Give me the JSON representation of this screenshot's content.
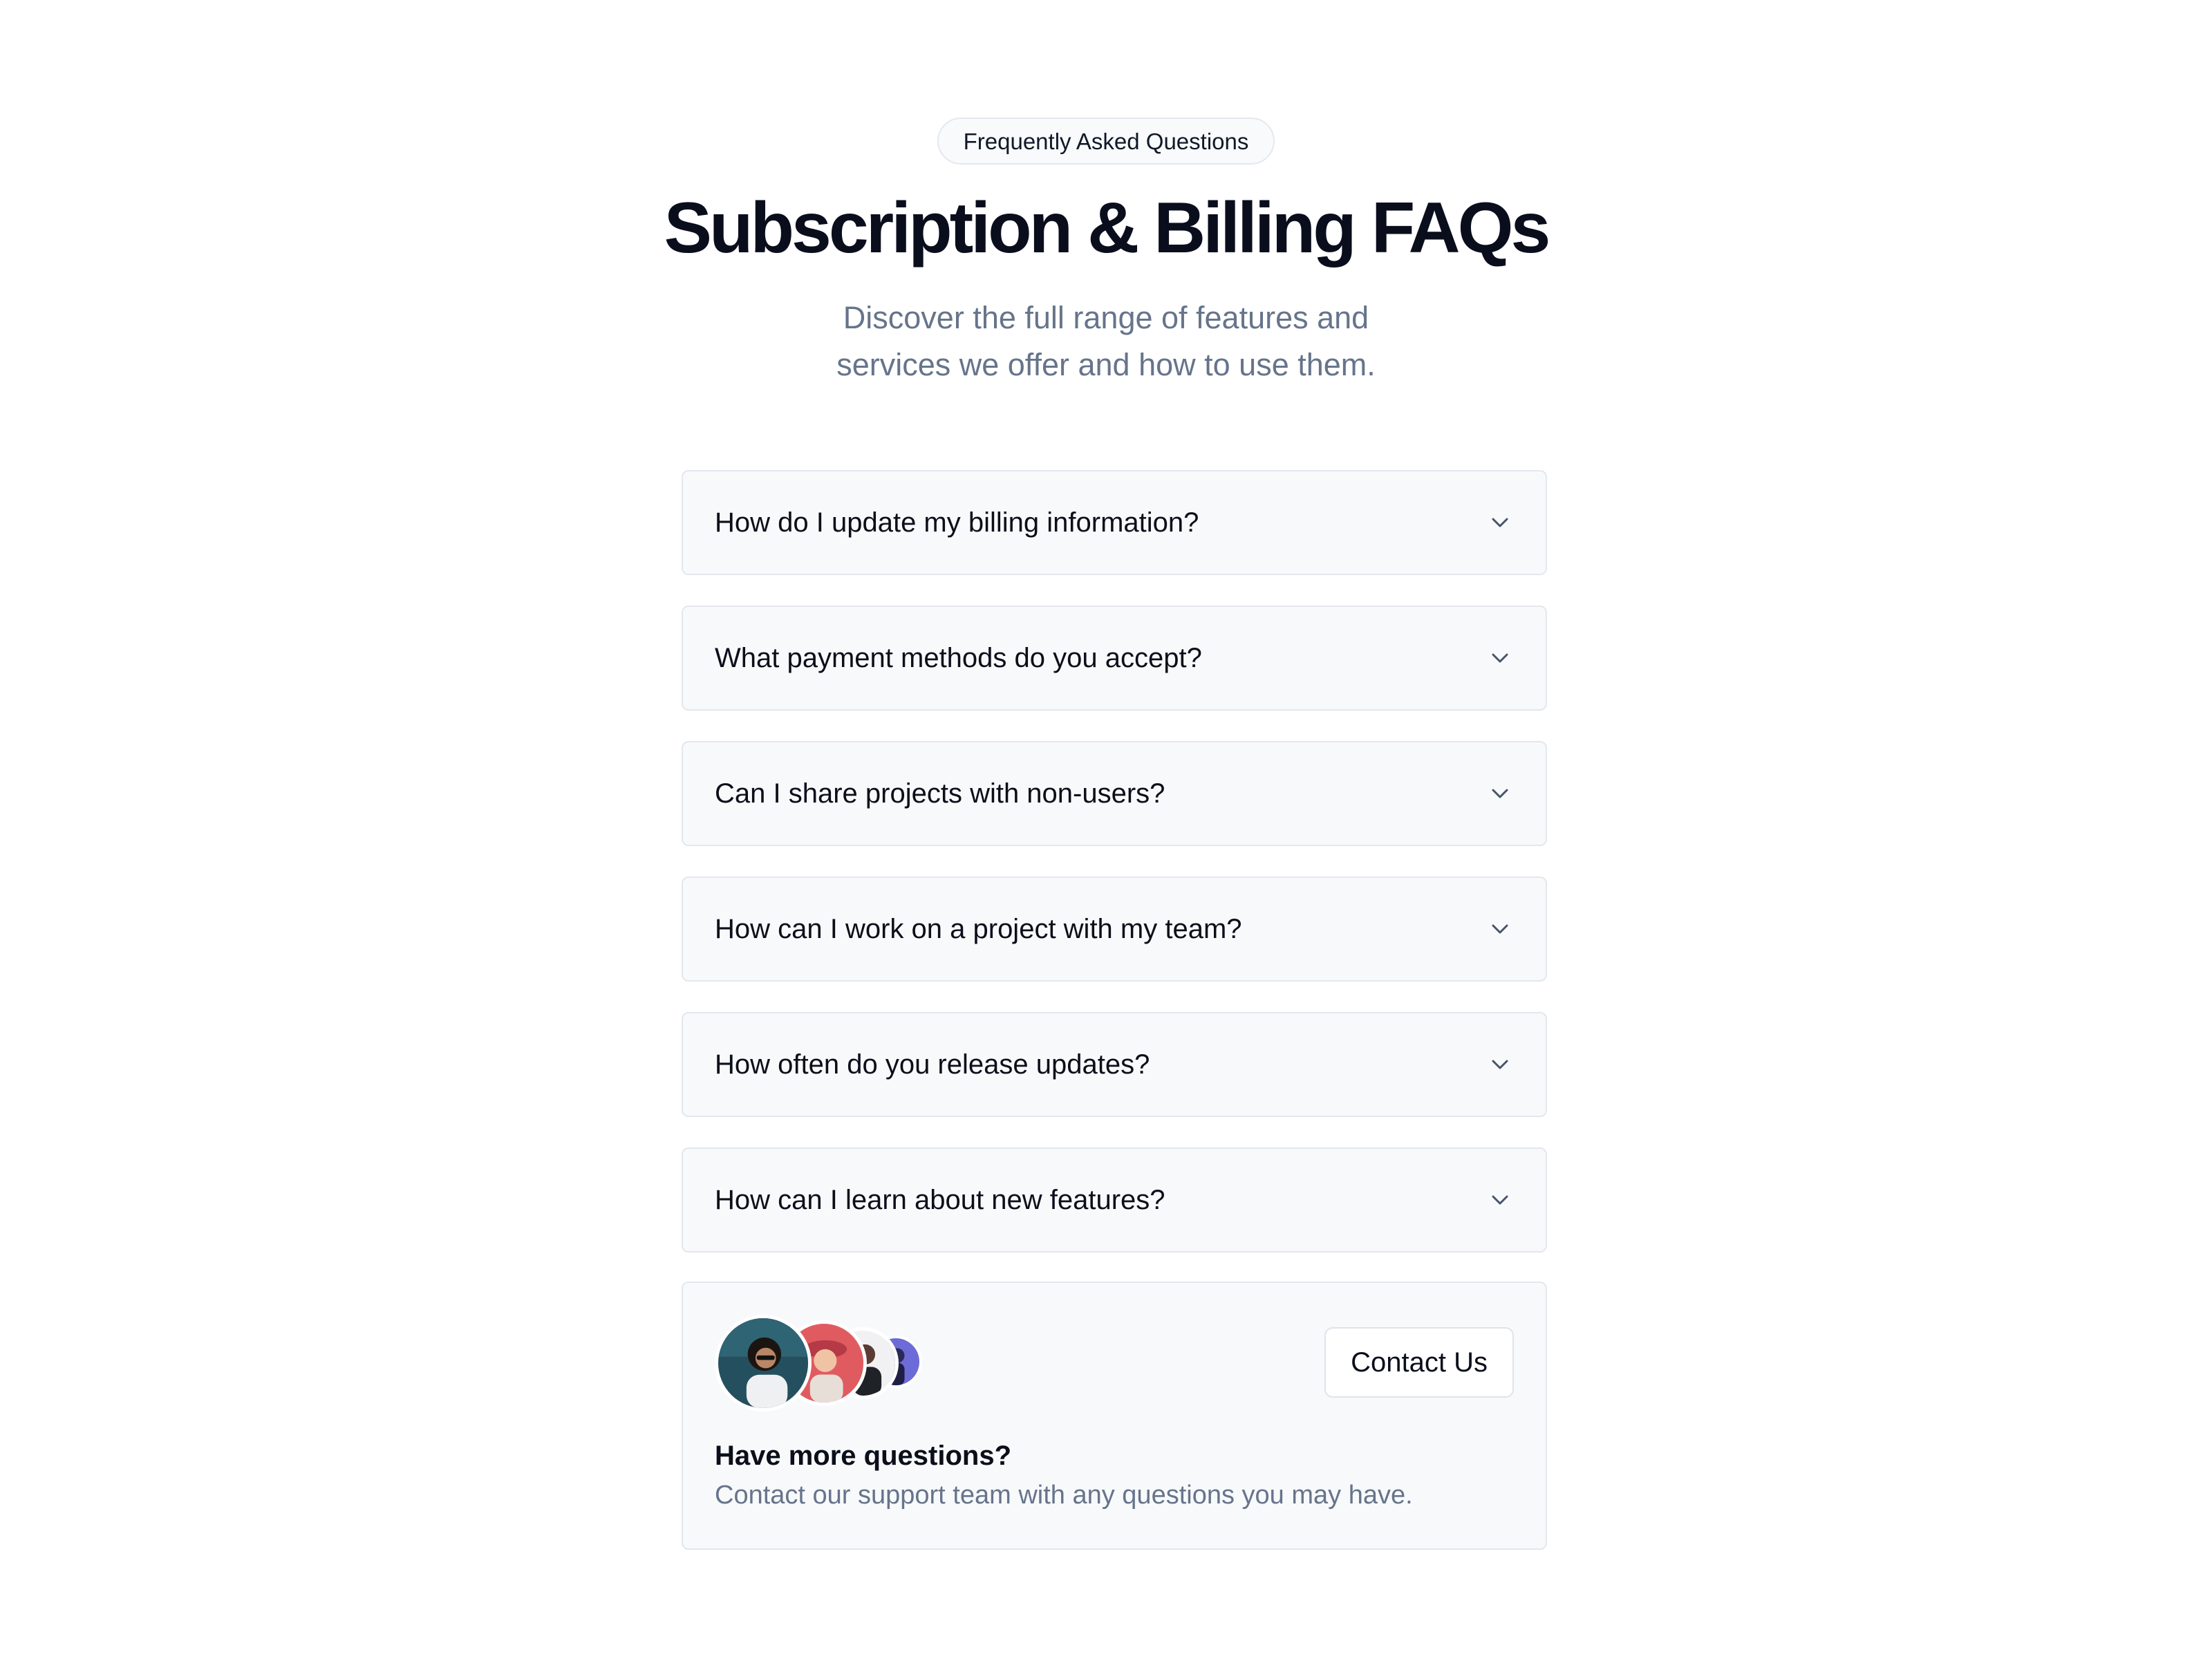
{
  "header": {
    "badge": "Frequently Asked Questions",
    "title": "Subscription & Billing FAQs",
    "subtitle": "Discover the full range of features and services we offer and how to use them."
  },
  "faq": {
    "items": [
      {
        "question": "How do I update my billing information?",
        "icon": "chevron-down-icon"
      },
      {
        "question": "What payment methods do you accept?",
        "icon": "chevron-down-icon"
      },
      {
        "question": "Can I share projects with non-users?",
        "icon": "chevron-down-icon"
      },
      {
        "question": "How can I work on a project with my team?",
        "icon": "chevron-down-icon"
      },
      {
        "question": "How often do you release updates?",
        "icon": "chevron-down-icon"
      },
      {
        "question": "How can I learn about new features?",
        "icon": "chevron-down-icon"
      }
    ]
  },
  "contact": {
    "button_label": "Contact Us",
    "heading": "Have more questions?",
    "text": "Contact our support team with any questions you may have.",
    "avatars": [
      "avatar",
      "avatar",
      "avatar",
      "avatar"
    ]
  },
  "colors": {
    "title": "#0a0e1c",
    "muted_text": "#66748b",
    "card_background": "#f8f9fb",
    "card_border": "#e3e7ee"
  }
}
